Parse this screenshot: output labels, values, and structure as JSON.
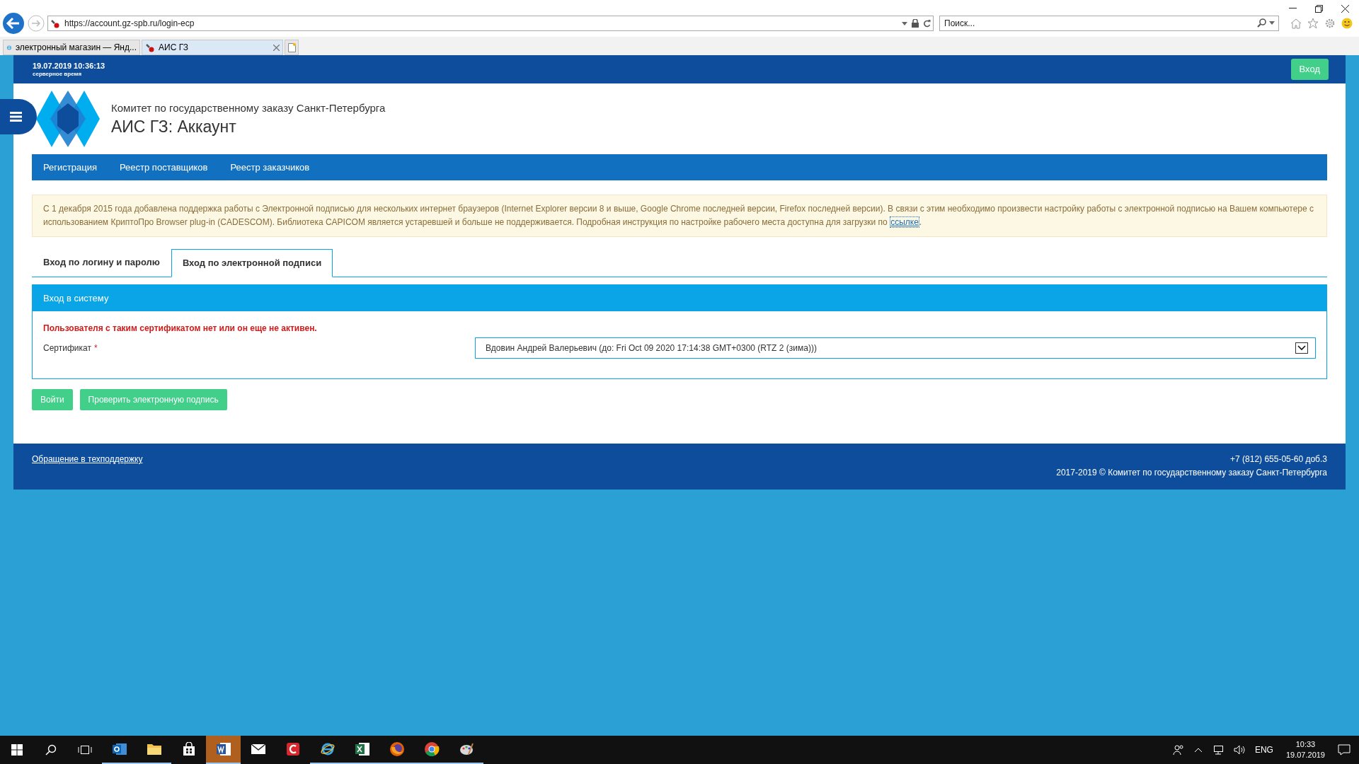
{
  "browser": {
    "address": "https://account.gz-spb.ru/login-ecp",
    "search_placeholder": "Поиск...",
    "tabs": [
      {
        "label": "электронный магазин — Янд...",
        "selected": false
      },
      {
        "label": "АИС ГЗ",
        "selected": true
      }
    ]
  },
  "top_bar": {
    "server_time": "19.07.2019 10:36:13",
    "server_time_label": "серверное время",
    "login_button": "Вход"
  },
  "header": {
    "organization": "Комитет по государственному заказу Санкт-Петербурга",
    "title": "АИС ГЗ: Аккаунт"
  },
  "nav": [
    "Регистрация",
    "Реестр поставщиков",
    "Реестр заказчиков"
  ],
  "notice": {
    "text": "С 1 декабря 2015 года добавлена поддержка работы с Электронной подписью для нескольких интернет браузеров (Internet Explorer версии 8 и выше, Google Chrome последней версии, Firefox последней версии). В связи с этим необходимо произвести настройку работы с электронной подписью на Вашем компьютере с использованием КриптоПро Browser plug-in (CADESCOM). Библиотека CAPICOM является устаревшей и больше не поддерживается. Подробная инструкция по настройке рабочего места доступна для загрузки по",
    "link": "ссылке",
    "end": "."
  },
  "login_tabs": [
    {
      "label": "Вход по логину и паролю",
      "selected": false
    },
    {
      "label": "Вход по электронной подписи",
      "selected": true
    }
  ],
  "panel": {
    "title": "Вход в систему",
    "error": "Пользователя с таким сертификатом нет или он еще не активен.",
    "field": {
      "label": "Сертификат",
      "required_mark": "*",
      "value": "Вдовин Андрей Валерьевич (до: Fri Oct 09 2020 17:14:38 GMT+0300 (RTZ 2 (зима)))"
    }
  },
  "buttons": [
    "Войти",
    "Проверить электронную подпись"
  ],
  "footer": {
    "support_link": "Обращение в техподдержку",
    "phone": "+7 (812) 655-05-60 доб.3",
    "copyright": "2017-2019 © Комитет по государственному заказу Санкт-Петербурга"
  },
  "taskbar": {
    "apps": [
      {
        "kind": "outlook",
        "running": true,
        "selected": false
      },
      {
        "kind": "explorer",
        "running": true,
        "selected": false
      },
      {
        "kind": "store",
        "running": false,
        "selected": false
      },
      {
        "kind": "word",
        "running": true,
        "selected": true
      },
      {
        "kind": "mail",
        "running": false,
        "selected": false
      },
      {
        "kind": "red",
        "running": false,
        "selected": false
      },
      {
        "kind": "ie",
        "running": true,
        "selected": false
      },
      {
        "kind": "excel",
        "running": true,
        "selected": false
      },
      {
        "kind": "firefox",
        "running": true,
        "selected": false
      },
      {
        "kind": "chrome",
        "running": true,
        "selected": false
      },
      {
        "kind": "paint",
        "running": true,
        "selected": false
      }
    ],
    "language": "ENG",
    "time": "10:33",
    "date": "19.07.2019"
  }
}
